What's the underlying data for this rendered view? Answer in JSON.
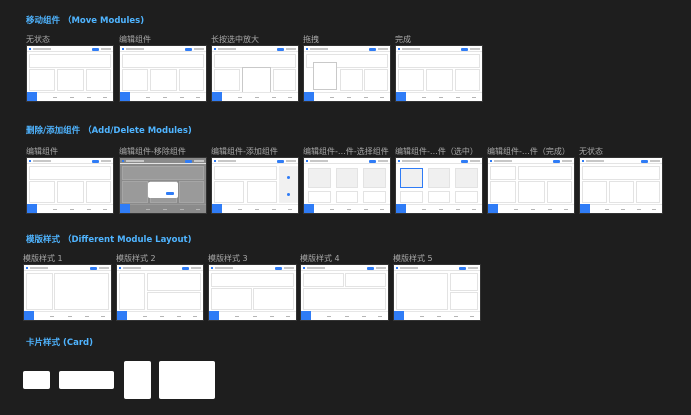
{
  "sections": {
    "move": {
      "title": "移动组件 （Move Modules)",
      "frames": [
        "无状态",
        "编辑组件",
        "长按选中放大",
        "拖拽",
        "完成"
      ]
    },
    "add_delete": {
      "title": "删除/添加组件 （Add/Delete Modules)",
      "frames": [
        "编辑组件",
        "编辑组件-移除组件",
        "编辑组件-添加组件",
        "编辑组件-…件-选择组件",
        "编辑组件-…件（选中）",
        "编辑组件-…件（完成）",
        "无状态"
      ]
    },
    "layout": {
      "title": "模版样式 （Different Module Layout)",
      "frames": [
        "模版样式 1",
        "模版样式 2",
        "模版样式 3",
        "模版样式 4",
        "模版样式 5"
      ]
    },
    "card": {
      "title": "卡片样式 (Card)"
    }
  },
  "colors": {
    "background": "#1e1e1e",
    "section_title": "#4fb4ff",
    "frame_label": "#a8a8a8",
    "accent": "#2f7cf6"
  }
}
